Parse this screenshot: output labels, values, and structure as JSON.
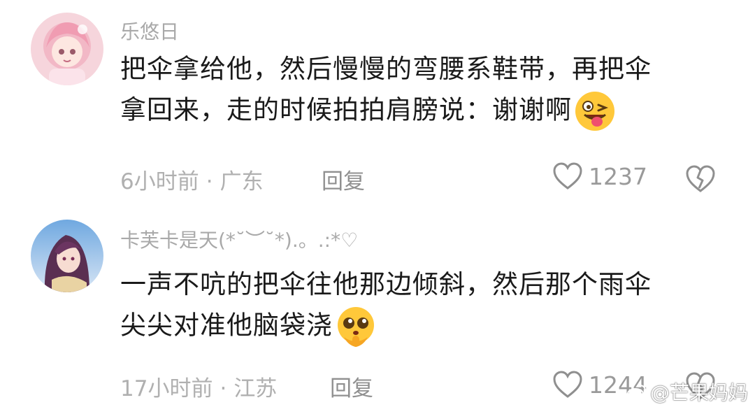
{
  "comments": [
    {
      "username": "乐悠日",
      "lines": [
        "把伞拿给他，然后慢慢的弯腰系鞋带，再把伞",
        "拿回来，走的时候拍拍肩膀说：谢谢啊"
      ],
      "emoji": "winking-tongue-emoji",
      "time": "6小时前",
      "location": "广东",
      "reply_label": "回复",
      "likes": "1237"
    },
    {
      "username": "卡芙卡是天(*˘︶˘*).。.:*♡",
      "lines": [
        "一声不吭的把伞往他那边倾斜，然后那个雨伞",
        "尖尖对准他脑袋浇"
      ],
      "emoji": "pleading-face-emoji",
      "time": "17小时前",
      "location": "江苏",
      "reply_label": "回复",
      "likes": "1244"
    }
  ],
  "watermark": "@芒果妈妈",
  "colors": {
    "text": "#1a1a1a",
    "muted": "#b0b0b0",
    "icon": "#8f8f8f"
  }
}
